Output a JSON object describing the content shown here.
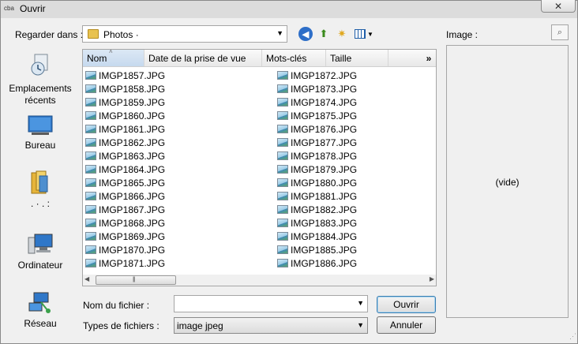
{
  "window": {
    "app_icon": "cba",
    "title": "Ouvrir",
    "close_glyph": "✕"
  },
  "toolbar": {
    "look_in_label": "Regarder dans :",
    "look_in_value": "Photos ·",
    "combo_arrow": "▼",
    "back_glyph": "◀",
    "up_glyph": "⬆",
    "new_folder_glyph": "✷",
    "view_arrow": "▼"
  },
  "preview": {
    "label": "Image :",
    "empty_text": "(vide)",
    "toggle_glyph": "⌕"
  },
  "places": [
    {
      "label": "Emplacements récents",
      "icon": "recent-places-icon"
    },
    {
      "label": "Bureau",
      "icon": "desktop-icon"
    },
    {
      "label": ". · . :",
      "icon": "libraries-icon"
    },
    {
      "label": "Ordinateur",
      "icon": "computer-icon"
    },
    {
      "label": "Réseau",
      "icon": "network-icon"
    }
  ],
  "columns": {
    "name": "Nom",
    "date": "Date de la prise de vue",
    "tags": "Mots-clés",
    "size": "Taille",
    "more": "»",
    "sort_glyph": "˄"
  },
  "files_col1": [
    "IMGP1857.JPG",
    "IMGP1858.JPG",
    "IMGP1859.JPG",
    "IMGP1860.JPG",
    "IMGP1861.JPG",
    "IMGP1862.JPG",
    "IMGP1863.JPG",
    "IMGP1864.JPG",
    "IMGP1865.JPG",
    "IMGP1866.JPG",
    "IMGP1867.JPG",
    "IMGP1868.JPG",
    "IMGP1869.JPG",
    "IMGP1870.JPG",
    "IMGP1871.JPG"
  ],
  "files_col2": [
    "IMGP1872.JPG",
    "IMGP1873.JPG",
    "IMGP1874.JPG",
    "IMGP1875.JPG",
    "IMGP1876.JPG",
    "IMGP1877.JPG",
    "IMGP1878.JPG",
    "IMGP1879.JPG",
    "IMGP1880.JPG",
    "IMGP1881.JPG",
    "IMGP1882.JPG",
    "IMGP1883.JPG",
    "IMGP1884.JPG",
    "IMGP1885.JPG",
    "IMGP1886.JPG"
  ],
  "scrollbar": {
    "left": "◀",
    "right": "▶",
    "grip": "|||"
  },
  "footer": {
    "filename_label": "Nom du fichier :",
    "filename_value": "",
    "filetype_label": "Types de fichiers :",
    "filetype_value": "image jpeg",
    "select_arrow": "▼",
    "open_label": "Ouvrir",
    "cancel_label": "Annuler",
    "grip": "⋰"
  }
}
